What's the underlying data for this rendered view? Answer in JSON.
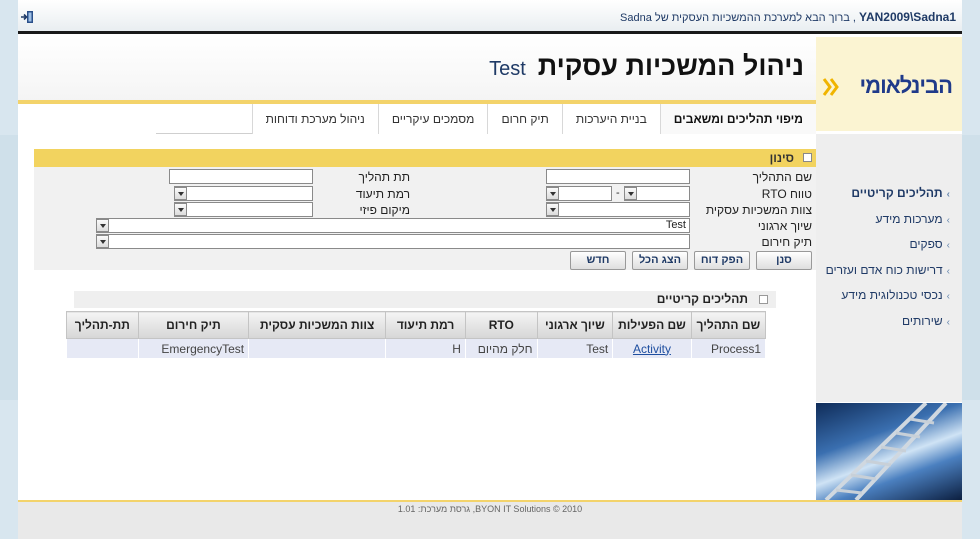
{
  "topbar": {
    "user": "YAN2009\\Sadna1",
    "welcome_text": ", ברוך הבא למערכת ההמשכיות העסקית של Sadna"
  },
  "header": {
    "title": "ניהול המשכיות עסקית",
    "subtitle": "Test",
    "logo_text": "הבינלאומי"
  },
  "nav": {
    "tabs": [
      {
        "label": "מיפוי תהליכים ומשאבים",
        "active": true
      },
      {
        "label": "בניית היערכות"
      },
      {
        "label": "תיק חרום"
      },
      {
        "label": "מסמכים עיקריים"
      },
      {
        "label": "ניהול מערכת ודוחות"
      }
    ]
  },
  "sidebar": {
    "items": [
      {
        "label": "תהליכים קריטיים",
        "active": true
      },
      {
        "label": "מערכות מידע"
      },
      {
        "label": "ספקים"
      },
      {
        "label": "דרישות כוח אדם ועזרים"
      },
      {
        "label": "נכסי טכנולוגית מידע"
      },
      {
        "label": "שירותים"
      }
    ]
  },
  "filter": {
    "title": "סינון",
    "labels": {
      "process_name": "שם התהליך",
      "rto_range": "טווח RTO",
      "bc_team": "צוות המשכיות עסקית",
      "org_assoc": "שיוך ארגוני",
      "emergency_file": "תיק חירום",
      "sub_process": "תת תהליך",
      "doc_level": "רמת תיעוד",
      "location": "מיקום פיזי"
    },
    "values": {
      "org_assoc": "Test"
    },
    "buttons": {
      "filter": "סנן",
      "report": "הפק דוח",
      "show_all": "הצג הכל",
      "new": "חדש"
    }
  },
  "results": {
    "title": "תהליכים קריטיים",
    "columns": [
      "שם התהליך",
      "שם הפעילות",
      "שיוך ארגוני",
      "RTO",
      "רמת תיעוד",
      "צוות המשכיות עסקית",
      "תיק חירום",
      "תת-תהליך"
    ],
    "rows": [
      {
        "process": "Process1",
        "activity": "Activity",
        "org": "Test",
        "rto": "חלק מהיום",
        "doc_level": "H",
        "team": "",
        "emergency": "EmergencyTest",
        "sub": ""
      }
    ]
  },
  "footer": {
    "text": "BYON IT Solutions © 2010, גרסת מערכת: 1.01"
  }
}
